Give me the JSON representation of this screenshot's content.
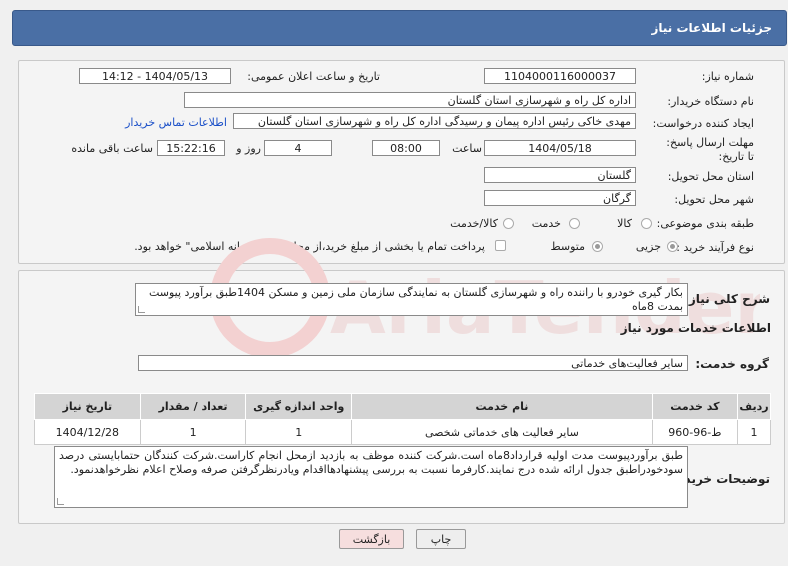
{
  "header": {
    "title": "جزئیات اطلاعات نیاز"
  },
  "fields": {
    "need_number_label": "شماره نیاز:",
    "need_number": "1104000116000037",
    "announce_label": "تاریخ و ساعت اعلان عمومی:",
    "announce_value": "1404/05/13 - 14:12",
    "buyer_label": "نام دستگاه خریدار:",
    "buyer_value": "اداره کل راه و شهرسازی استان گلستان",
    "creator_label": "ایجاد کننده درخواست:",
    "creator_value": "مهدی خاکی رئیس اداره پیمان و رسیدگی اداره کل راه و شهرسازی استان گلستان",
    "contact_link": "اطلاعات تماس خریدار",
    "deadline_label": "مهلت ارسال پاسخ: تا تاریخ:",
    "deadline_date": "1404/05/18",
    "time_label": "ساعت",
    "deadline_time": "08:00",
    "days_value": "4",
    "days_label": "روز و",
    "remaining_value": "15:22:16",
    "remaining_label": "ساعت باقی مانده",
    "province_label": "استان محل تحویل:",
    "province_value": "گلستان",
    "city_label": "شهر محل تحویل:",
    "city_value": "گرگان",
    "category_label": "طبقه بندی موضوعی:",
    "category_options": [
      "کالا",
      "خدمت",
      "کالا/خدمت"
    ],
    "process_label": "نوع فرآیند خرید :",
    "process_options": [
      "جزیی",
      "متوسط"
    ],
    "payment_note": "پرداخت تمام یا بخشی از مبلغ خرید،از محل \"اسناد خزانه اسلامی\" خواهد بود."
  },
  "description": {
    "label": "شرح کلی نیاز:",
    "text": "بکار گیری خودرو با راننده راه و شهرسازی گلستان به نمایندگی سازمان ملی زمین و مسکن 1404طبق برآورد پیوست بمدت 8ماه"
  },
  "services": {
    "section_title": "اطلاعات خدمات مورد نیاز",
    "group_label": "گروه خدمت:",
    "group_value": "سایر فعالیت‌های خدماتی",
    "columns": [
      "ردیف",
      "کد خدمت",
      "نام خدمت",
      "واحد اندازه گیری",
      "تعداد / مقدار",
      "تاریخ نیاز"
    ],
    "rows": [
      [
        "1",
        "ط-96-960",
        "سایر فعالیت های خدماتی شخصی",
        "1",
        "1",
        "1404/12/28"
      ]
    ]
  },
  "buyer_notes": {
    "label": "توضیحات خریدار:",
    "text": "طبق برآوردپیوست مدت اولیه قرارداد8ماه است.شرکت کننده موظف به بازدید ازمحل انجام کاراست.شرکت کنندگان حتمابایستی درصد سودخودراطبق جدول ارائه شده درج نمایند.کارفرما نسبت به بررسی پیشنهادهااقدام ویادرنظرگرفتن صرفه وصلاح اعلام نظرخواهدنمود."
  },
  "buttons": {
    "print": "چاپ",
    "back": "بازگشت"
  },
  "colors": {
    "header": "#4a6fa5",
    "link": "#1a4fc8",
    "back_button": "#f6dede"
  }
}
